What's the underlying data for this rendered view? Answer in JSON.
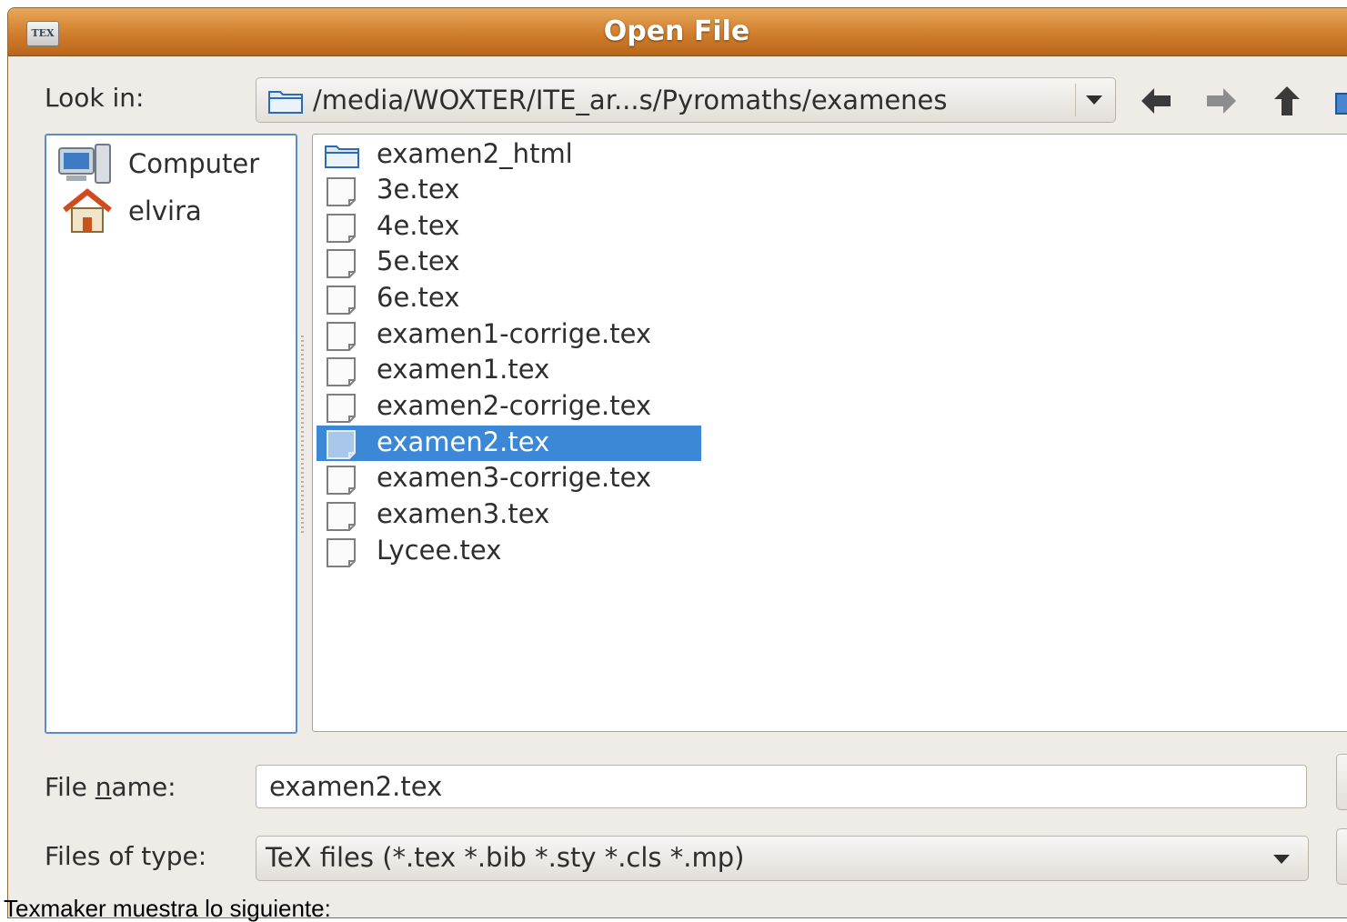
{
  "window": {
    "title": "Open File",
    "app_icon_text": "TEX"
  },
  "look_in": {
    "label": "Look in:",
    "path": "/media/WOXTER/ITE_ar...s/Pyromaths/examenes"
  },
  "places": [
    {
      "label": "Computer",
      "icon": "computer-icon"
    },
    {
      "label": "elvira",
      "icon": "home-icon"
    }
  ],
  "files": [
    {
      "name": "examen2_html",
      "icon": "folder-icon"
    },
    {
      "name": "3e.tex",
      "icon": "document-icon"
    },
    {
      "name": "4e.tex",
      "icon": "document-icon"
    },
    {
      "name": "5e.tex",
      "icon": "document-icon"
    },
    {
      "name": "6e.tex",
      "icon": "document-icon"
    },
    {
      "name": "examen1-corrige.tex",
      "icon": "document-icon"
    },
    {
      "name": "examen1.tex",
      "icon": "document-icon"
    },
    {
      "name": "examen2-corrige.tex",
      "icon": "document-icon"
    },
    {
      "name": "examen2.tex",
      "icon": "document-icon",
      "selected": true
    },
    {
      "name": "examen3-corrige.tex",
      "icon": "document-icon"
    },
    {
      "name": "examen3.tex",
      "icon": "document-icon"
    },
    {
      "name": "Lycee.tex",
      "icon": "document-icon"
    }
  ],
  "file_name": {
    "label_pre": "File ",
    "label_mnemonic": "n",
    "label_post": "ame:",
    "value": "examen2.tex"
  },
  "file_type": {
    "label": "Files of type:",
    "value": "TeX files (*.tex *.bib *.sty *.cls *.mp)"
  },
  "caption": "Texmaker muestra lo siguiente:",
  "colors": {
    "titlebar": "#d07e2c",
    "selection": "#3d88d6",
    "places_border": "#5b8cc7"
  }
}
